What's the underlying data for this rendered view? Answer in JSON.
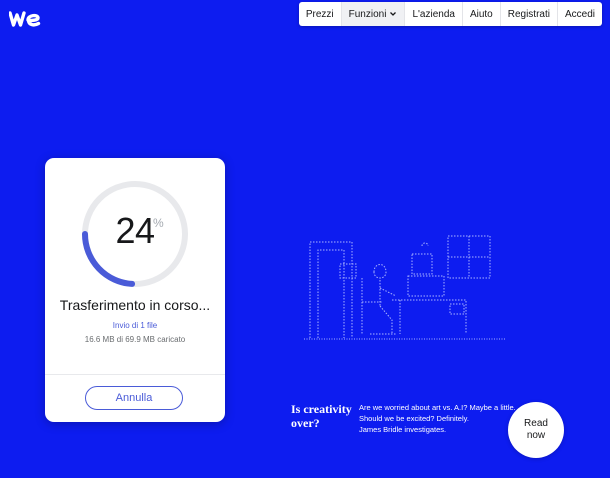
{
  "brand": {
    "logo_icon": "wetransfer-logo-icon",
    "background": "#0d1cf0",
    "accent": "#4a5bd8"
  },
  "nav": {
    "items": [
      {
        "label": "Prezzi"
      },
      {
        "label": "Funzioni",
        "has_dropdown": true
      },
      {
        "label": "L'azienda"
      },
      {
        "label": "Aiuto"
      },
      {
        "label": "Registrati"
      },
      {
        "label": "Accedi"
      }
    ]
  },
  "transfer": {
    "progress_percent": 24,
    "percent_value": "24",
    "percent_sign": "%",
    "title": "Trasferimento in corso...",
    "files_text": "Invio di 1 file",
    "size_text": "16.6 MB di 69.9 MB caricato",
    "cancel_label": "Annulla"
  },
  "promo": {
    "title_line1": "Is creativity",
    "title_line2": "over?",
    "text_lines": [
      "Are we worried about art vs. A.I? Maybe a little.",
      "Should we be excited? Definitely.",
      "James Bridle investigates."
    ],
    "cta_line1": "Read",
    "cta_line2": "now"
  }
}
